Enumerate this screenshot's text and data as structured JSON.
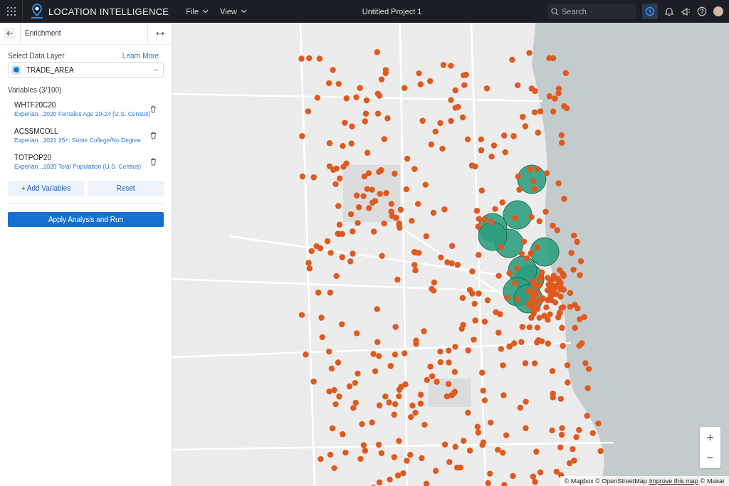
{
  "topbar": {
    "app_name": "LOCATION INTELLIGENCE",
    "menus": [
      {
        "label": "File"
      },
      {
        "label": "View"
      }
    ],
    "project_title": "Untitled Project 1",
    "search": {
      "placeholder": "Search"
    },
    "history_active": true
  },
  "panel": {
    "title": "Enrichment",
    "data_layer_label": "Select Data Layer",
    "learn_more": "Learn More",
    "data_layer_value": "TRADE_AREA",
    "variables_label": "Variables (3/100)",
    "variables": [
      {
        "code": "WHTF20C20",
        "description": "Experian...2020 Females Age 20-24 (U.S. Census)"
      },
      {
        "code": "ACSSMCOLL",
        "description": "Experian...2021 25+: Some College/No Degree"
      },
      {
        "code": "TOTPOP20",
        "description": "Experian...2020 Total Population (U.S. Census)"
      }
    ],
    "buttons": [
      "+ Add Variables",
      "Reset"
    ],
    "primary_button": "Apply Analysis and Run"
  },
  "map": {
    "zoom_in": "+",
    "zoom_out": "−",
    "attribution_parts": [
      {
        "text": "© Mapbox © OpenStreetMap",
        "kind": "text"
      },
      {
        "text": "Improve this map",
        "kind": "link"
      },
      {
        "text": "© Maxar",
        "kind": "text"
      }
    ]
  }
}
